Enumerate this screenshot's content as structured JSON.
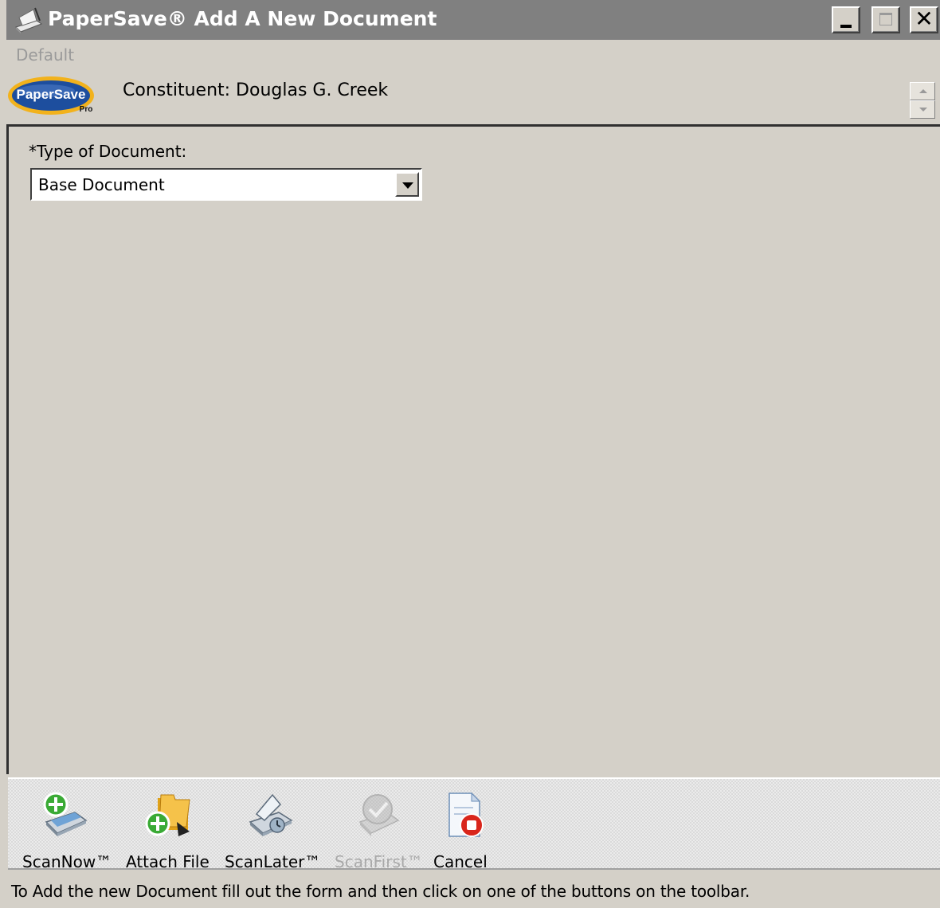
{
  "window": {
    "title": "PaperSave® Add A New Document",
    "menu_default": "Default"
  },
  "header": {
    "logo_text": "PaperSave",
    "logo_sub": "Pro",
    "constituent": "Constituent: Douglas G. Creek"
  },
  "form": {
    "type_label": "*Type of Document:",
    "type_value": "Base Document"
  },
  "toolbar": {
    "scan_now": "ScanNow™",
    "attach_file": "Attach File",
    "scan_later": "ScanLater™",
    "scan_first": "ScanFirst™",
    "cancel": "Cancel"
  },
  "status": {
    "text": "To Add the new Document fill out the form and then click on one of the buttons on the toolbar."
  },
  "colors": {
    "titlebar": "#808080",
    "window_bg": "#d4d0c8",
    "logo_blue": "#1d4e9e",
    "logo_gold": "#f2b21c",
    "green_plus": "#3aaa35",
    "cancel_red": "#d9261c"
  }
}
